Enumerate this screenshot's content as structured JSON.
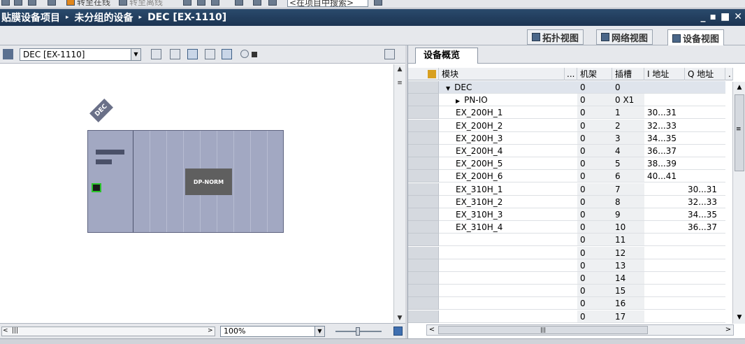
{
  "toolbar": {
    "go_online": "转至在线",
    "go_offline": "转至离线",
    "search_placeholder": "<在项目中搜索>"
  },
  "titlebar": {
    "crumbs": [
      "贴膜设备项目",
      "未分组的设备",
      "DEC [EX-1110]"
    ],
    "sep": "▸",
    "controls": [
      "_",
      "▪",
      "■",
      "✕"
    ]
  },
  "view_tabs": {
    "topology": "拓扑视图",
    "network": "网络视图",
    "device": "设备视图"
  },
  "device_toolbar": {
    "device_select": "DEC [EX-1110]",
    "zoom": "100%"
  },
  "canvas": {
    "device_tag": "DEC",
    "module_label": "DP-NORM"
  },
  "overview": {
    "tab_label": "设备概览",
    "columns": [
      "模块",
      "...",
      "机架",
      "插槽",
      "I 地址",
      "Q 地址",
      "."
    ],
    "rows": [
      {
        "module": "DEC",
        "rack": "0",
        "slot": "0",
        "i": "",
        "q": "",
        "expand": "▼"
      },
      {
        "module": "PN-IO",
        "rack": "0",
        "slot": "0 X1",
        "i": "",
        "q": "",
        "expand": "▶"
      },
      {
        "module": "EX_200H_1",
        "rack": "0",
        "slot": "1",
        "i": "30...31",
        "q": ""
      },
      {
        "module": "EX_200H_2",
        "rack": "0",
        "slot": "2",
        "i": "32...33",
        "q": ""
      },
      {
        "module": "EX_200H_3",
        "rack": "0",
        "slot": "3",
        "i": "34...35",
        "q": ""
      },
      {
        "module": "EX_200H_4",
        "rack": "0",
        "slot": "4",
        "i": "36...37",
        "q": ""
      },
      {
        "module": "EX_200H_5",
        "rack": "0",
        "slot": "5",
        "i": "38...39",
        "q": ""
      },
      {
        "module": "EX_200H_6",
        "rack": "0",
        "slot": "6",
        "i": "40...41",
        "q": ""
      },
      {
        "module": "EX_310H_1",
        "rack": "0",
        "slot": "7",
        "i": "",
        "q": "30...31"
      },
      {
        "module": "EX_310H_2",
        "rack": "0",
        "slot": "8",
        "i": "",
        "q": "32...33"
      },
      {
        "module": "EX_310H_3",
        "rack": "0",
        "slot": "9",
        "i": "",
        "q": "34...35"
      },
      {
        "module": "EX_310H_4",
        "rack": "0",
        "slot": "10",
        "i": "",
        "q": "36...37"
      },
      {
        "module": "",
        "rack": "0",
        "slot": "11",
        "i": "",
        "q": ""
      },
      {
        "module": "",
        "rack": "0",
        "slot": "12",
        "i": "",
        "q": ""
      },
      {
        "module": "",
        "rack": "0",
        "slot": "13",
        "i": "",
        "q": ""
      },
      {
        "module": "",
        "rack": "0",
        "slot": "14",
        "i": "",
        "q": ""
      },
      {
        "module": "",
        "rack": "0",
        "slot": "15",
        "i": "",
        "q": ""
      },
      {
        "module": "",
        "rack": "0",
        "slot": "16",
        "i": "",
        "q": ""
      },
      {
        "module": "",
        "rack": "0",
        "slot": "17",
        "i": "",
        "q": ""
      }
    ]
  },
  "scroll_glyphs": {
    "up": "▲",
    "down": "▼",
    "left": "◀",
    "right": "▶",
    "left_lt": "<",
    "right_gt": ">",
    "grip": "|||",
    "menu": "≡"
  }
}
